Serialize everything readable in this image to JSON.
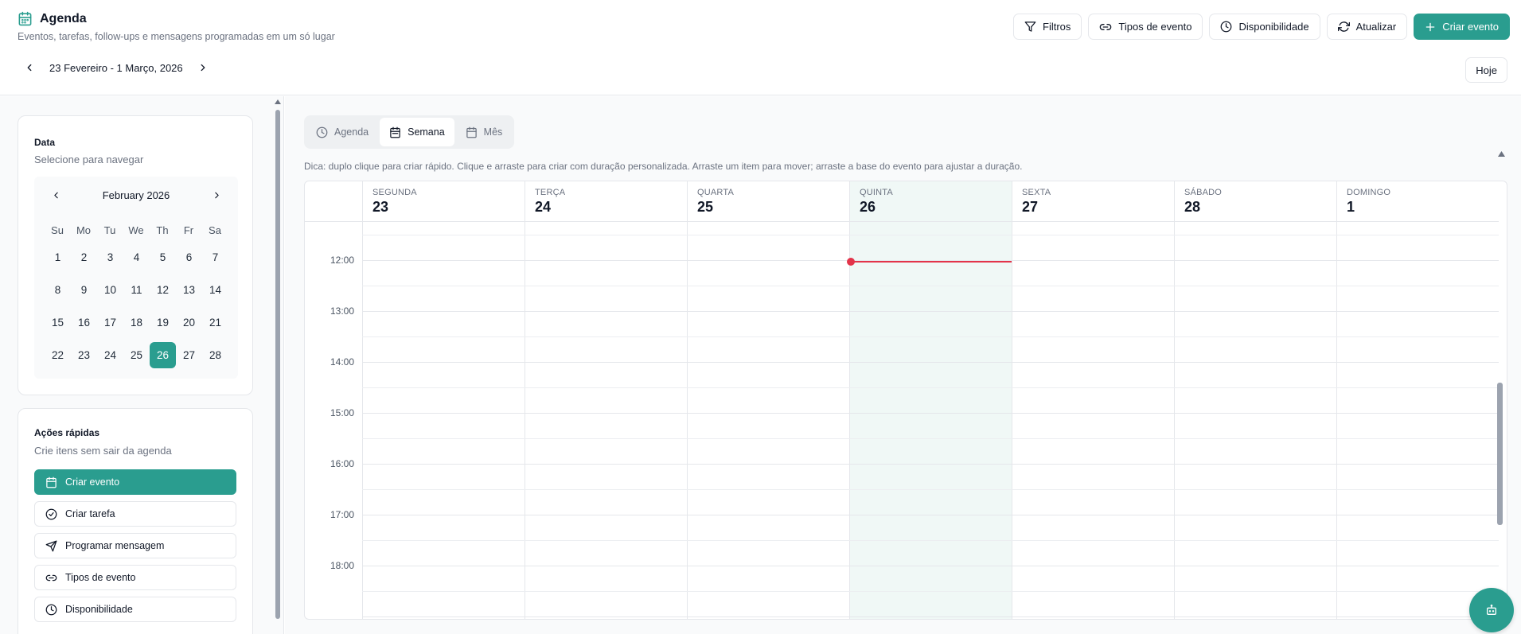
{
  "header": {
    "title": "Agenda",
    "subtitle": "Eventos, tarefas, follow-ups e mensagens programadas em um só lugar",
    "buttons": {
      "filters": "Filtros",
      "event_types": "Tipos de evento",
      "availability": "Disponibilidade",
      "refresh": "Atualizar",
      "create_event": "Criar evento"
    },
    "date_range": "23 Fevereiro - 1 Março, 2026",
    "today": "Hoje"
  },
  "sidebar": {
    "date_card": {
      "title": "Data",
      "subtitle": "Selecione para navegar",
      "month": "February 2026",
      "weekdays": [
        "Su",
        "Mo",
        "Tu",
        "We",
        "Th",
        "Fr",
        "Sa"
      ],
      "weeks": [
        [
          "1",
          "2",
          "3",
          "4",
          "5",
          "6",
          "7"
        ],
        [
          "8",
          "9",
          "10",
          "11",
          "12",
          "13",
          "14"
        ],
        [
          "15",
          "16",
          "17",
          "18",
          "19",
          "20",
          "21"
        ],
        [
          "22",
          "23",
          "24",
          "25",
          "26",
          "27",
          "28"
        ]
      ],
      "selected": "26"
    },
    "quick_actions": {
      "title": "Ações rápidas",
      "subtitle": "Crie itens sem sair da agenda",
      "items": [
        {
          "label": "Criar evento",
          "icon": "calendar-icon"
        },
        {
          "label": "Criar tarefa",
          "icon": "check-circle-icon"
        },
        {
          "label": "Programar mensagem",
          "icon": "send-icon"
        },
        {
          "label": "Tipos de evento",
          "icon": "link-icon"
        },
        {
          "label": "Disponibilidade",
          "icon": "clock-icon"
        }
      ]
    }
  },
  "view_tabs": [
    {
      "label": "Agenda",
      "icon": "clock-icon",
      "active": false
    },
    {
      "label": "Semana",
      "icon": "calendar-icon",
      "active": true
    },
    {
      "label": "Mês",
      "icon": "calendar-icon",
      "active": false
    }
  ],
  "tip": "Dica: duplo clique para criar rápido. Clique e arraste para criar com duração personalizada. Arraste um item para mover; arraste a base do evento para ajustar a duração.",
  "week": {
    "days": [
      {
        "name": "SEGUNDA",
        "num": "23"
      },
      {
        "name": "TERÇA",
        "num": "24"
      },
      {
        "name": "QUARTA",
        "num": "25"
      },
      {
        "name": "QUINTA",
        "num": "26",
        "today": true
      },
      {
        "name": "SEXTA",
        "num": "27"
      },
      {
        "name": "SÁBADO",
        "num": "28"
      },
      {
        "name": "DOMINGO",
        "num": "1"
      }
    ],
    "hours": [
      "12:00",
      "13:00",
      "14:00",
      "15:00",
      "16:00",
      "17:00",
      "18:00"
    ]
  },
  "colors": {
    "accent": "#2a9d8f",
    "now_indicator": "#e3344a",
    "today_column": "#f0f8f6"
  }
}
